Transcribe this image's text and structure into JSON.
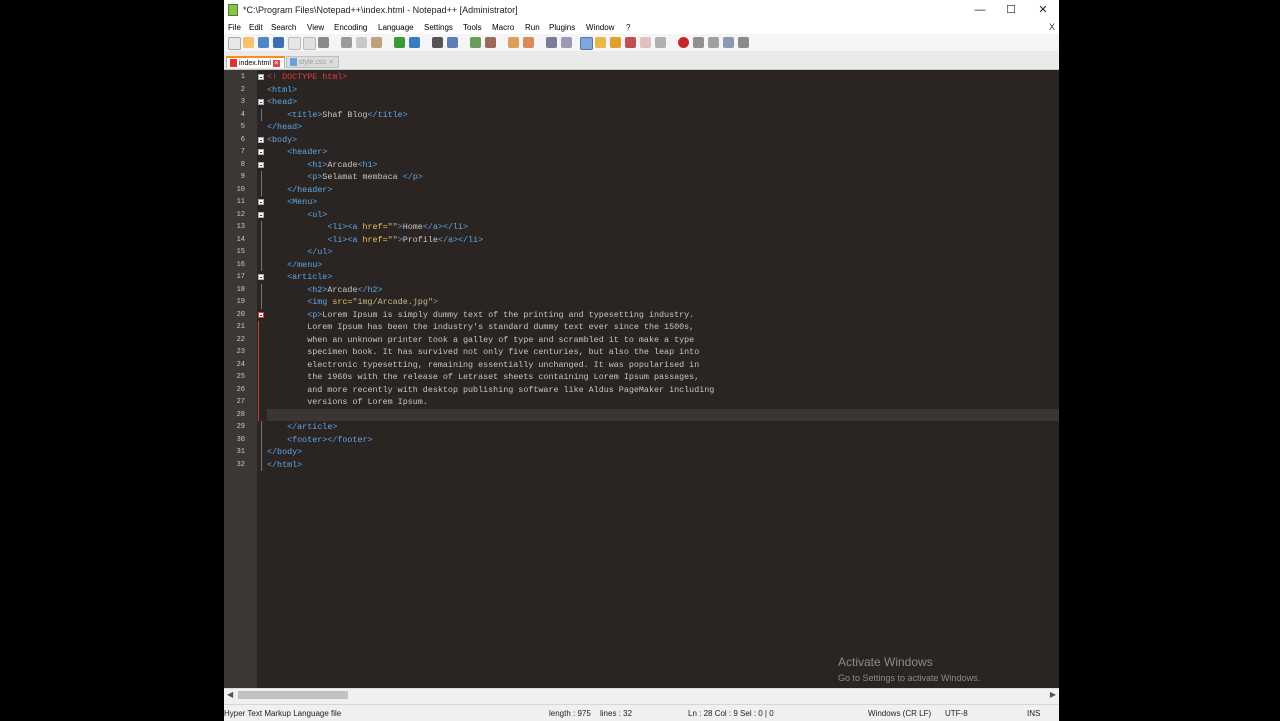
{
  "window": {
    "title": "*C:\\Program Files\\Notepad++\\index.html - Notepad++ [Administrator]",
    "controls": {
      "minimize": "—",
      "maximize": "☐",
      "close": "✕"
    }
  },
  "menu": [
    "File",
    "Edit",
    "Search",
    "View",
    "Encoding",
    "Language",
    "Settings",
    "Tools",
    "Macro",
    "Run",
    "Plugins",
    "Window",
    "?"
  ],
  "menu_close": "X",
  "tabs": [
    {
      "label": "index.html",
      "active": true
    },
    {
      "label": "style.css",
      "active": false
    }
  ],
  "lines": [
    {
      "num": "1",
      "segs": [
        {
          "c": "t-doc",
          "t": "<! DOCTYPE html>"
        }
      ]
    },
    {
      "num": "2",
      "segs": [
        {
          "c": "t-tag",
          "t": "<html>"
        }
      ]
    },
    {
      "num": "3",
      "segs": [
        {
          "c": "t-tag",
          "t": "<head>"
        }
      ]
    },
    {
      "num": "4",
      "segs": [
        {
          "c": "t-txt",
          "t": "    "
        },
        {
          "c": "t-tag",
          "t": "<title>"
        },
        {
          "c": "t-txt",
          "t": "Shaf Blog"
        },
        {
          "c": "t-tag",
          "t": "</title>"
        }
      ]
    },
    {
      "num": "5",
      "segs": [
        {
          "c": "t-tag",
          "t": "</head>"
        }
      ]
    },
    {
      "num": "6",
      "segs": [
        {
          "c": "t-tag",
          "t": "<body>"
        }
      ]
    },
    {
      "num": "7",
      "segs": [
        {
          "c": "t-txt",
          "t": "    "
        },
        {
          "c": "t-tag",
          "t": "<header>"
        }
      ]
    },
    {
      "num": "8",
      "segs": [
        {
          "c": "t-txt",
          "t": "        "
        },
        {
          "c": "t-tag",
          "t": "<h1>"
        },
        {
          "c": "t-txt",
          "t": "Arcade"
        },
        {
          "c": "t-tag",
          "t": "<h1>"
        }
      ]
    },
    {
      "num": "9",
      "segs": [
        {
          "c": "t-txt",
          "t": "        "
        },
        {
          "c": "t-tag",
          "t": "<p>"
        },
        {
          "c": "t-txt",
          "t": "Selamat membaca "
        },
        {
          "c": "t-tag",
          "t": "</p>"
        }
      ]
    },
    {
      "num": "10",
      "segs": [
        {
          "c": "t-txt",
          "t": "    "
        },
        {
          "c": "t-tag",
          "t": "</header>"
        }
      ]
    },
    {
      "num": "11",
      "segs": [
        {
          "c": "t-txt",
          "t": "    "
        },
        {
          "c": "t-tag",
          "t": "<Menu>"
        }
      ]
    },
    {
      "num": "12",
      "segs": [
        {
          "c": "t-txt",
          "t": "        "
        },
        {
          "c": "t-tag",
          "t": "<ul>"
        }
      ]
    },
    {
      "num": "13",
      "segs": [
        {
          "c": "t-txt",
          "t": "            "
        },
        {
          "c": "t-tag",
          "t": "<li><a "
        },
        {
          "c": "t-attr",
          "t": "href="
        },
        {
          "c": "t-str",
          "t": "\"\""
        },
        {
          "c": "t-tag",
          "t": ">"
        },
        {
          "c": "t-txt",
          "t": "Home"
        },
        {
          "c": "t-tag",
          "t": "</a></li>"
        }
      ]
    },
    {
      "num": "14",
      "segs": [
        {
          "c": "t-txt",
          "t": "            "
        },
        {
          "c": "t-tag",
          "t": "<li><a "
        },
        {
          "c": "t-attr",
          "t": "href="
        },
        {
          "c": "t-str",
          "t": "\"\""
        },
        {
          "c": "t-tag",
          "t": ">"
        },
        {
          "c": "t-txt",
          "t": "Profile"
        },
        {
          "c": "t-tag",
          "t": "</a></li>"
        }
      ]
    },
    {
      "num": "15",
      "segs": [
        {
          "c": "t-txt",
          "t": "        "
        },
        {
          "c": "t-tag",
          "t": "</ul>"
        }
      ]
    },
    {
      "num": "16",
      "segs": [
        {
          "c": "t-txt",
          "t": "    "
        },
        {
          "c": "t-tag",
          "t": "</menu>"
        }
      ]
    },
    {
      "num": "17",
      "segs": [
        {
          "c": "t-txt",
          "t": "    "
        },
        {
          "c": "t-tag",
          "t": "<article>"
        }
      ]
    },
    {
      "num": "18",
      "segs": [
        {
          "c": "t-txt",
          "t": "        "
        },
        {
          "c": "t-tag",
          "t": "<h2>"
        },
        {
          "c": "t-txt",
          "t": "Arcade"
        },
        {
          "c": "t-tag",
          "t": "</h2>"
        }
      ]
    },
    {
      "num": "19",
      "segs": [
        {
          "c": "t-txt",
          "t": "        "
        },
        {
          "c": "t-tag",
          "t": "<img "
        },
        {
          "c": "t-attr",
          "t": "src="
        },
        {
          "c": "t-str",
          "t": "\"img/Arcade.jpg\""
        },
        {
          "c": "t-tag",
          "t": ">"
        }
      ]
    },
    {
      "num": "20",
      "segs": [
        {
          "c": "t-txt",
          "t": "        "
        },
        {
          "c": "t-tag",
          "t": "<p>"
        },
        {
          "c": "t-txt",
          "t": "Lorem Ipsum is simply dummy text of the printing and typesetting industry."
        }
      ]
    },
    {
      "num": "21",
      "segs": [
        {
          "c": "t-txt",
          "t": "        Lorem Ipsum has been the industry's standard dummy text ever since the 1500s,"
        }
      ]
    },
    {
      "num": "22",
      "segs": [
        {
          "c": "t-txt",
          "t": "        when an unknown printer took a galley of type and scrambled it to make a type"
        }
      ]
    },
    {
      "num": "23",
      "segs": [
        {
          "c": "t-txt",
          "t": "        specimen book. It has survived not only five centuries, but also the leap into"
        }
      ]
    },
    {
      "num": "24",
      "segs": [
        {
          "c": "t-txt",
          "t": "        electronic typesetting, remaining essentially unchanged. It was popularised in"
        }
      ]
    },
    {
      "num": "25",
      "segs": [
        {
          "c": "t-txt",
          "t": "        the 1960s with the release of Letraset sheets containing Lorem Ipsum passages,"
        }
      ]
    },
    {
      "num": "26",
      "segs": [
        {
          "c": "t-txt",
          "t": "        and more recently with desktop publishing software like Aldus PageMaker including"
        }
      ]
    },
    {
      "num": "27",
      "segs": [
        {
          "c": "t-txt",
          "t": "        versions of Lorem Ipsum."
        }
      ]
    },
    {
      "num": "28",
      "segs": [
        {
          "c": "t-txt",
          "t": ""
        }
      ]
    },
    {
      "num": "29",
      "segs": [
        {
          "c": "t-txt",
          "t": "    "
        },
        {
          "c": "t-tag",
          "t": "</article>"
        }
      ]
    },
    {
      "num": "30",
      "segs": [
        {
          "c": "t-txt",
          "t": "    "
        },
        {
          "c": "t-tag",
          "t": "<footer></footer>"
        }
      ]
    },
    {
      "num": "31",
      "segs": [
        {
          "c": "t-tag",
          "t": "</body>"
        }
      ]
    },
    {
      "num": "32",
      "segs": [
        {
          "c": "t-tag",
          "t": "</html>"
        }
      ]
    }
  ],
  "status": {
    "file_type": "Hyper Text Markup Language file",
    "length": "length : 975",
    "lines": "lines : 32",
    "position": "Ln : 28   Col : 9   Sel : 0 | 0",
    "eol": "Windows (CR LF)",
    "encoding": "UTF-8",
    "mode": "INS"
  },
  "watermark": {
    "title": "Activate Windows",
    "subtitle": "Go to Settings to activate Windows."
  },
  "colors": {
    "editor_bg": "#2a2522",
    "tag": "#5fa7e8",
    "attr": "#e7c25a",
    "doctype": "#e23b3b",
    "text": "#c6c6c6",
    "active_tab_accent": "#fa8c1d"
  }
}
